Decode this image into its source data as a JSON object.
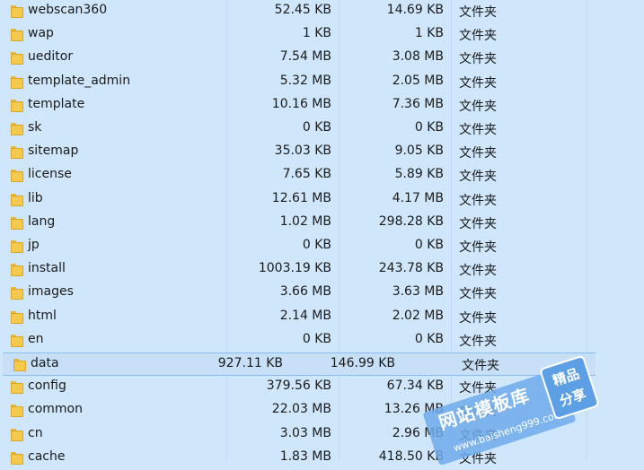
{
  "files": [
    {
      "name": "webscan360",
      "size": "52.45 KB",
      "compressed": "14.69 KB",
      "type": "文件夹"
    },
    {
      "name": "wap",
      "size": "1 KB",
      "compressed": "1 KB",
      "type": "文件夹"
    },
    {
      "name": "ueditor",
      "size": "7.54 MB",
      "compressed": "3.08 MB",
      "type": "文件夹"
    },
    {
      "name": "template_admin",
      "size": "5.32 MB",
      "compressed": "2.05 MB",
      "type": "文件夹"
    },
    {
      "name": "template",
      "size": "10.16 MB",
      "compressed": "7.36 MB",
      "type": "文件夹"
    },
    {
      "name": "sk",
      "size": "0 KB",
      "compressed": "0 KB",
      "type": "文件夹"
    },
    {
      "name": "sitemap",
      "size": "35.03 KB",
      "compressed": "9.05 KB",
      "type": "文件夹"
    },
    {
      "name": "license",
      "size": "7.65 KB",
      "compressed": "5.89 KB",
      "type": "文件夹"
    },
    {
      "name": "lib",
      "size": "12.61 MB",
      "compressed": "4.17 MB",
      "type": "文件夹"
    },
    {
      "name": "lang",
      "size": "1.02 MB",
      "compressed": "298.28 KB",
      "type": "文件夹"
    },
    {
      "name": "jp",
      "size": "0 KB",
      "compressed": "0 KB",
      "type": "文件夹"
    },
    {
      "name": "install",
      "size": "1003.19 KB",
      "compressed": "243.78 KB",
      "type": "文件夹"
    },
    {
      "name": "images",
      "size": "3.66 MB",
      "compressed": "3.63 MB",
      "type": "文件夹"
    },
    {
      "name": "html",
      "size": "2.14 MB",
      "compressed": "2.02 MB",
      "type": "文件夹"
    },
    {
      "name": "en",
      "size": "0 KB",
      "compressed": "0 KB",
      "type": "文件夹"
    },
    {
      "name": "data",
      "size": "927.11 KB",
      "compressed": "146.99 KB",
      "type": "文件夹"
    },
    {
      "name": "config",
      "size": "379.56 KB",
      "compressed": "67.34 KB",
      "type": "文件夹"
    },
    {
      "name": "common",
      "size": "22.03 MB",
      "compressed": "13.26 MB",
      "type": "文件夹"
    },
    {
      "name": "cn",
      "size": "3.03 MB",
      "compressed": "2.96 MB",
      "type": "文件夹"
    },
    {
      "name": "cache",
      "size": "1.83 MB",
      "compressed": "418.50 KB",
      "type": "文件夹"
    }
  ],
  "focused_row": "data",
  "watermark": {
    "title": "网站模板库",
    "url": "www.baisheng999.com",
    "badge_line1": "精品",
    "badge_line2": "分享"
  },
  "colors": {
    "background": "#cfe6fb",
    "folder": "#f5c94b",
    "watermark": "#5d9fe4"
  },
  "icons": {
    "folder": "folder-icon"
  }
}
